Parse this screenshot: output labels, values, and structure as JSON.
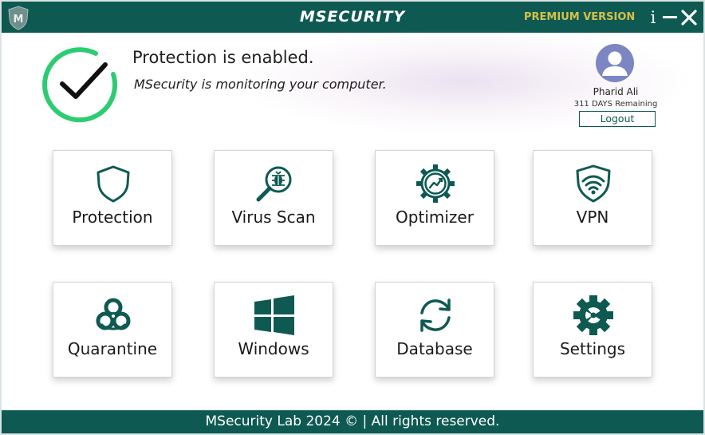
{
  "titlebar": {
    "brand": "MSECURITY",
    "edition": "PREMIUM VERSION",
    "info_label": "i",
    "logo_letter": "M"
  },
  "status": {
    "title": "Protection is enabled.",
    "subtitle": "MSecurity is monitoring your computer.",
    "ring_color": "#2ecc71"
  },
  "user": {
    "name": "Pharid Ali",
    "days_remaining": "311 DAYS Remaining",
    "logout_label": "Logout"
  },
  "tiles": [
    {
      "label": "Protection",
      "icon": "shield-icon"
    },
    {
      "label": "Virus Scan",
      "icon": "virus-scan-icon"
    },
    {
      "label": "Optimizer",
      "icon": "optimizer-gear-icon"
    },
    {
      "label": "VPN",
      "icon": "vpn-shield-wifi-icon"
    },
    {
      "label": "Quarantine",
      "icon": "biohazard-icon"
    },
    {
      "label": "Windows",
      "icon": "windows-icon"
    },
    {
      "label": "Database",
      "icon": "refresh-icon"
    },
    {
      "label": "Settings",
      "icon": "settings-gear-icon"
    }
  ],
  "footer": {
    "text": "MSecurity Lab 2024 © | All rights reserved."
  },
  "colors": {
    "brand": "#0e5a52",
    "premium": "#d4c04a",
    "accent_green": "#2ecc71",
    "avatar": "#7b86c2"
  }
}
